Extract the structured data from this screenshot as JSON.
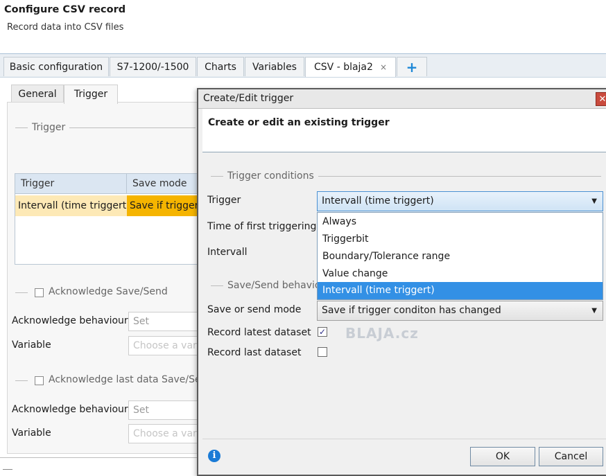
{
  "page": {
    "title": "Configure CSV record",
    "subtitle": "Record data into CSV files"
  },
  "tabs": [
    {
      "label": "Basic configuration"
    },
    {
      "label": "S7-1200/-1500"
    },
    {
      "label": "Charts"
    },
    {
      "label": "Variables"
    },
    {
      "label": "CSV - blaja2",
      "active": true,
      "close": "×"
    },
    {
      "label": "+"
    }
  ],
  "subtabs": [
    {
      "label": "General"
    },
    {
      "label": "Trigger",
      "active": true
    }
  ],
  "left": {
    "trigger_group": "Trigger",
    "grid": {
      "columns": [
        "Trigger",
        "Save mode"
      ],
      "rows": [
        {
          "trigger": "Intervall (time triggert)",
          "save_mode": "Save if trigger"
        }
      ]
    },
    "ack_group": "Acknowledge Save/Send",
    "ack_behaviour_label": "Acknowledge behaviour",
    "ack_behaviour_value": "Set",
    "variable_label": "Variable",
    "variable_placeholder": "Choose a varia",
    "ack_last_group": "Acknowledge last data Save/Send",
    "ack_last_behaviour_label": "Acknowledge behaviour",
    "ack_last_behaviour_value": "Set",
    "variable2_label": "Variable",
    "variable2_placeholder": "Choose a varia"
  },
  "dialog": {
    "title": "Create/Edit trigger",
    "close": "✕",
    "header": "Create or edit an existing trigger",
    "conditions_group": "Trigger conditions",
    "trigger_label": "Trigger",
    "trigger_value": "Intervall (time triggert)",
    "first_trigger_label": "Time of first triggering",
    "interval_label": "Intervall",
    "options": [
      "Always",
      "Triggerbit",
      "Boundary/Tolerance range",
      "Value change",
      "Intervall (time triggert)"
    ],
    "selected_option": "Intervall (time triggert)",
    "save_group": "Save/Send behavio",
    "save_mode_label": "Save  or send mode",
    "save_mode_value": "Save if trigger conditon has changed",
    "record_latest_label": "Record latest dataset",
    "record_latest_checked": true,
    "record_last_label": "Record last dataset",
    "record_last_checked": false,
    "ok": "OK",
    "cancel": "Cancel",
    "watermark": "BLAJA.cz"
  },
  "colors": {
    "accent": "#3390e5",
    "grid_row_bg": "#fde9b6",
    "grid_row_highlight": "#f5b400",
    "info": "#1a7bd6"
  },
  "icons": {
    "info": "info-icon",
    "dropdown": "chevron-down-icon",
    "close": "close-icon",
    "add": "plus-icon"
  }
}
